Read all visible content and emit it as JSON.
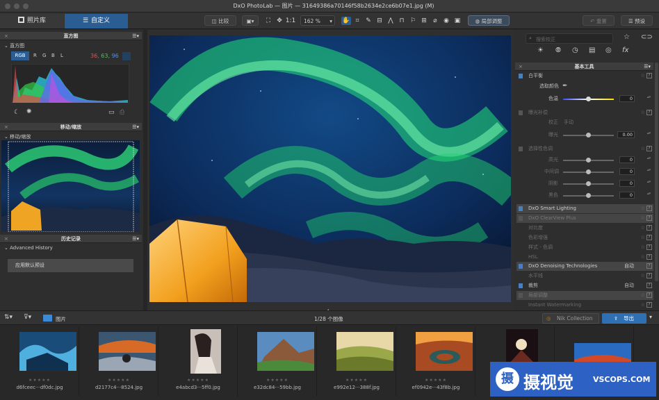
{
  "window": {
    "title": "DxO PhotoLab — 图片 — 31649386a70146f58b2634e2ce6b07e1.jpg (M)"
  },
  "toolbar": {
    "tab_library": "照片库",
    "tab_customize": "自定义",
    "compare_label": "比较",
    "zoom_1to1": "1:1",
    "zoom_level": "162 %",
    "local_adjust_label": "局部调整",
    "reset_label": "重置",
    "preset_label": "预设"
  },
  "histogram": {
    "panel_title": "直方图",
    "section": "直方图",
    "modes": [
      "RGB",
      "R",
      "G",
      "B",
      "L"
    ],
    "r_value": "36,",
    "g_value": "63,",
    "b_value": "96"
  },
  "navigator": {
    "panel_title": "移动/缩放",
    "section": "移动/缩放"
  },
  "history": {
    "panel_title": "历史记录",
    "section": "Advanced History",
    "item": "应用默认预设"
  },
  "right_panel": {
    "search_placeholder": "搜索校正",
    "tools_title": "基本工具",
    "white_balance": "白平衡",
    "pick_color": "选取颜色",
    "color_temp": "色温",
    "color_temp_value": "0",
    "exposure_comp": "曝光补偿",
    "correction": "校正",
    "correction_value": "手动",
    "exposure": "曝光",
    "exposure_value": "0.00",
    "selective_tone": "选择性色调",
    "highlights": "高光",
    "highlights_value": "0",
    "midtones": "中间调",
    "midtones_value": "0",
    "shadows": "阴影",
    "shadows_value": "0",
    "blacks": "黑色",
    "blacks_value": "0",
    "smart_lighting": "DxO Smart Lighting",
    "clearview": "DxO ClearView Plus",
    "contrast": "对比度",
    "color_enhance": "色彩增强",
    "style_tone": "样式 - 色调",
    "hsl": "HSL",
    "denoising": "DxO Denoising Technologies",
    "denoising_mode": "自动",
    "horizon": "水平线",
    "crop": "裁剪",
    "crop_mode": "自动",
    "local_adjust": "局部调整",
    "watermark": "Instant Watermarking"
  },
  "filmstrip": {
    "folder": "图片",
    "count": "1/28 个图像",
    "nik_collection": "Nik Collection",
    "export_label": "导出",
    "items": [
      {
        "name": "d6fceec···df0dc.jpg"
      },
      {
        "name": "d2177c4···8524.jpg"
      },
      {
        "name": "e4abcd3···5ff0.jpg"
      },
      {
        "name": "e32dc84···59bb.jpg"
      },
      {
        "name": "e992e12···388f.jpg"
      },
      {
        "name": "ef0942e···43f8b.jpg"
      }
    ]
  },
  "watermark_logo": {
    "text": "摄视觉",
    "domain": "VSCOPS.COM"
  },
  "colors": {
    "accent": "#2f6fb3",
    "selected_tab": "#2a5d91",
    "background": "#2b2b2b"
  }
}
